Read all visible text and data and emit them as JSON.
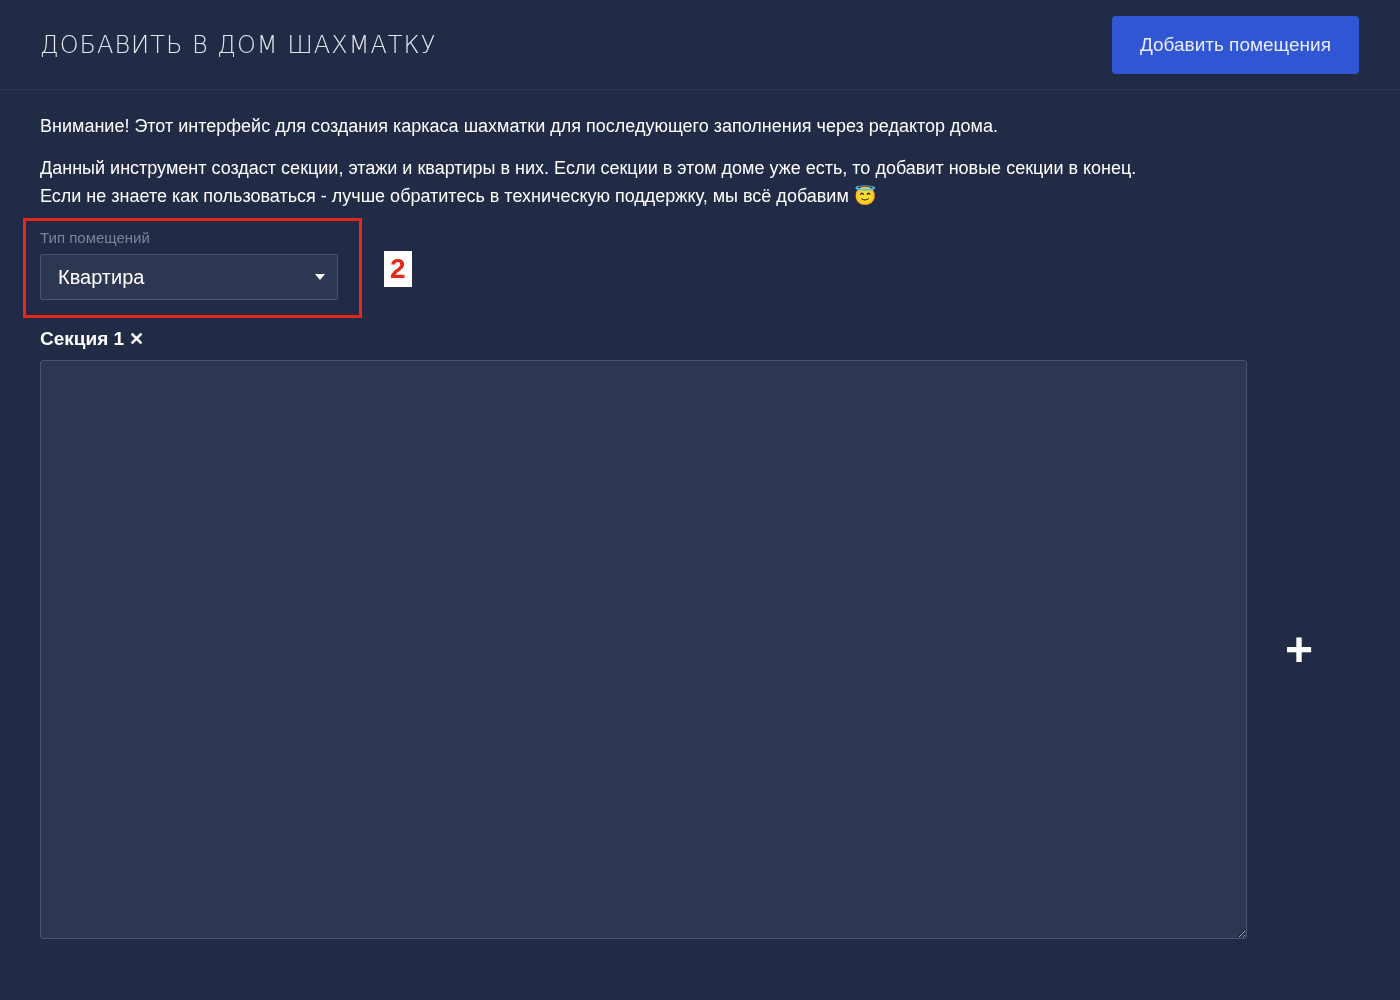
{
  "header": {
    "title": "ДОБАВИТЬ В ДОМ ШАХМАТКУ",
    "button": "Добавить помещения"
  },
  "notice": "Внимание! Этот интерфейс для создания каркаса шахматки для последующего заполнения через редактор дома.",
  "info_lines": [
    "Данный инструмент создаст секции, этажи и квартиры в них. Если секции в этом доме уже есть, то добавит новые секции в конец.",
    "Если не знаете как пользоваться - лучше обратитесь в техническую поддержку, мы всё добавим 😇"
  ],
  "room_type": {
    "label": "Тип помещений",
    "value": "Квартира",
    "highlighted": true,
    "annotation": "2"
  },
  "sections": [
    {
      "title": "Секция 1",
      "remove": "✕"
    }
  ],
  "add": "+"
}
